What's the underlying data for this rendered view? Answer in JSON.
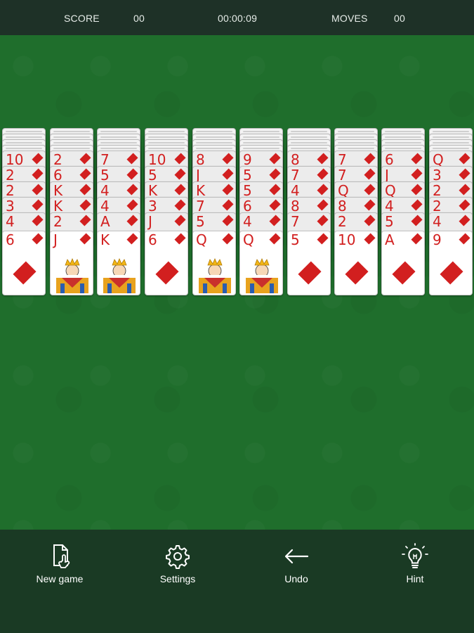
{
  "header": {
    "score_label": "SCORE",
    "score_value": "00",
    "timer": "00:00:09",
    "moves_label": "MOVES",
    "moves_value": "00"
  },
  "colors": {
    "felt": "#1f6e2c",
    "topbar": "#1e3127",
    "bottombar": "#1a3a24",
    "suit_red": "#d21f1f"
  },
  "tableau": [
    {
      "backs": 4,
      "partial": [
        "10",
        "2",
        "2",
        "3",
        "4"
      ],
      "top": "6",
      "top_face": false
    },
    {
      "backs": 4,
      "partial": [
        "2",
        "6",
        "K",
        "K",
        "2"
      ],
      "top": "J",
      "top_face": true
    },
    {
      "backs": 4,
      "partial": [
        "7",
        "5",
        "4",
        "4",
        "A"
      ],
      "top": "K",
      "top_face": true
    },
    {
      "backs": 4,
      "partial": [
        "10",
        "5",
        "K",
        "3",
        "J"
      ],
      "top": "6",
      "top_face": false
    },
    {
      "backs": 4,
      "partial": [
        "8",
        "J",
        "K",
        "7",
        "5"
      ],
      "top": "Q",
      "top_face": true
    },
    {
      "backs": 4,
      "partial": [
        "9",
        "5",
        "5",
        "6",
        "4"
      ],
      "top": "Q",
      "top_face": true
    },
    {
      "backs": 4,
      "partial": [
        "8",
        "7",
        "4",
        "8",
        "7"
      ],
      "top": "5",
      "top_face": false
    },
    {
      "backs": 4,
      "partial": [
        "7",
        "7",
        "Q",
        "8",
        "2"
      ],
      "top": "10",
      "top_face": false
    },
    {
      "backs": 4,
      "partial": [
        "6",
        "J",
        "Q",
        "4",
        "5"
      ],
      "top": "A",
      "top_face": false
    },
    {
      "backs": 4,
      "partial": [
        "Q",
        "3",
        "2",
        "2",
        "4"
      ],
      "top": "9",
      "top_face": false
    }
  ],
  "toolbar": {
    "new_game": "New game",
    "settings": "Settings",
    "undo": "Undo",
    "hint": "Hint"
  }
}
